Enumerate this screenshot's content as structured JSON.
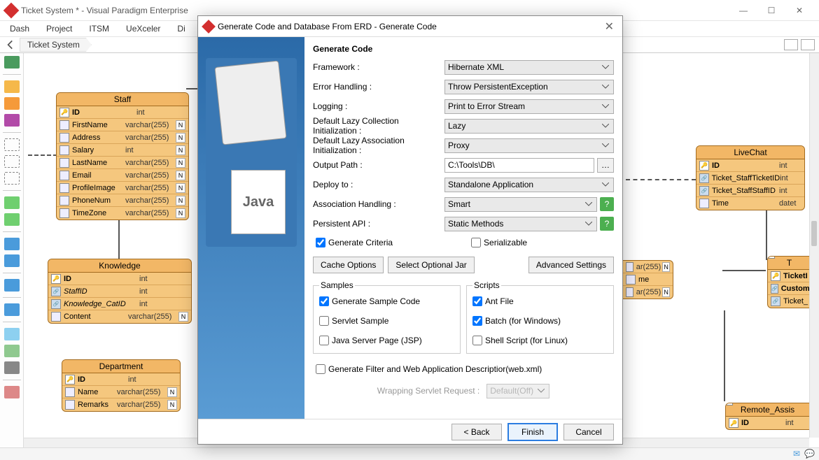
{
  "window": {
    "title": "Ticket System * - Visual Paradigm Enterprise",
    "breadcrumb": "Ticket System"
  },
  "menu": [
    "Dash",
    "Project",
    "ITSM",
    "UeXceler",
    "Di"
  ],
  "erd": {
    "staff": {
      "name": "Staff",
      "cols": [
        {
          "k": "ID",
          "t": "int",
          "pk": true
        },
        {
          "k": "FirstName",
          "t": "varchar(255)",
          "n": true
        },
        {
          "k": "Address",
          "t": "varchar(255)",
          "n": true
        },
        {
          "k": "Salary",
          "t": "int",
          "n": true
        },
        {
          "k": "LastName",
          "t": "varchar(255)",
          "n": true
        },
        {
          "k": "Email",
          "t": "varchar(255)",
          "n": true
        },
        {
          "k": "ProfileImage",
          "t": "varchar(255)",
          "n": true
        },
        {
          "k": "PhoneNum",
          "t": "varchar(255)",
          "n": true
        },
        {
          "k": "TimeZone",
          "t": "varchar(255)",
          "n": true
        }
      ]
    },
    "knowledge": {
      "name": "Knowledge",
      "cols": [
        {
          "k": "ID",
          "t": "int",
          "pk": true
        },
        {
          "k": "StaffID",
          "t": "int",
          "fk": true,
          "it": true
        },
        {
          "k": "Knowledge_CatID",
          "t": "int",
          "fk": true,
          "it": true
        },
        {
          "k": "Content",
          "t": "varchar(255)",
          "n": true
        }
      ]
    },
    "department": {
      "name": "Department",
      "cols": [
        {
          "k": "ID",
          "t": "int",
          "pk": true
        },
        {
          "k": "Name",
          "t": "varchar(255)",
          "n": true
        },
        {
          "k": "Remarks",
          "t": "varchar(255)",
          "n": true
        }
      ]
    },
    "livechat": {
      "name": "LiveChat",
      "cols": [
        {
          "k": "ID",
          "t": "int",
          "pk": true
        },
        {
          "k": "Ticket_StaffTicketID",
          "t": "int",
          "fk": true
        },
        {
          "k": "Ticket_StaffStaffID",
          "t": "int",
          "fk": true
        },
        {
          "k": "Time",
          "t": "datet"
        }
      ]
    },
    "ticket_partial": {
      "name": "T",
      "cols": [
        {
          "k": "TicketI",
          "pk": true
        },
        {
          "k": "Custom",
          "fk": true,
          "bold": true
        },
        {
          "k": "Ticket_",
          "fk": true
        }
      ]
    },
    "remote": {
      "name": "Remote_Assis",
      "cols": [
        {
          "k": "ID",
          "t": "int",
          "pk": true
        }
      ]
    },
    "partial_mid": {
      "cols": [
        {
          "t": "ar(255)",
          "n": true
        },
        {
          "k": "me"
        },
        {
          "t": "ar(255)",
          "n": true
        }
      ]
    }
  },
  "dialog": {
    "title": "Generate Code and Database From ERD - Generate Code",
    "heading": "Generate Code",
    "rows": {
      "framework": {
        "label": "Framework :",
        "value": "Hibernate XML"
      },
      "error": {
        "label": "Error Handling :",
        "value": "Throw PersistentException"
      },
      "logging": {
        "label": "Logging :",
        "value": "Print to Error Stream"
      },
      "lazycol": {
        "label": "Default Lazy Collection Initialization :",
        "value": "Lazy"
      },
      "lazyassoc": {
        "label": "Default Lazy Association Initialization :",
        "value": "Proxy"
      },
      "output": {
        "label": "Output Path :",
        "value": "C:\\Tools\\DB\\"
      },
      "deploy": {
        "label": "Deploy to :",
        "value": "Standalone Application"
      },
      "assoc": {
        "label": "Association Handling :",
        "value": "Smart"
      },
      "persist": {
        "label": "Persistent API :",
        "value": "Static Methods"
      }
    },
    "checks": {
      "criteria": "Generate Criteria",
      "serial": "Serializable",
      "sample_code": "Generate Sample Code",
      "servlet": "Servlet Sample",
      "jsp": "Java Server Page (JSP)",
      "ant": "Ant File",
      "batch": "Batch (for Windows)",
      "shell": "Shell Script (for Linux)",
      "filter": "Generate Filter and Web Application Descriptior(web.xml)"
    },
    "buttons": {
      "cache": "Cache Options",
      "jar": "Select Optional Jar",
      "adv": "Advanced Settings",
      "back": "< Back",
      "finish": "Finish",
      "cancel": "Cancel"
    },
    "groups": {
      "samples": "Samples",
      "scripts": "Scripts"
    },
    "wrap": {
      "label": "Wrapping Servlet Request :",
      "value": "Default(Off)"
    }
  }
}
